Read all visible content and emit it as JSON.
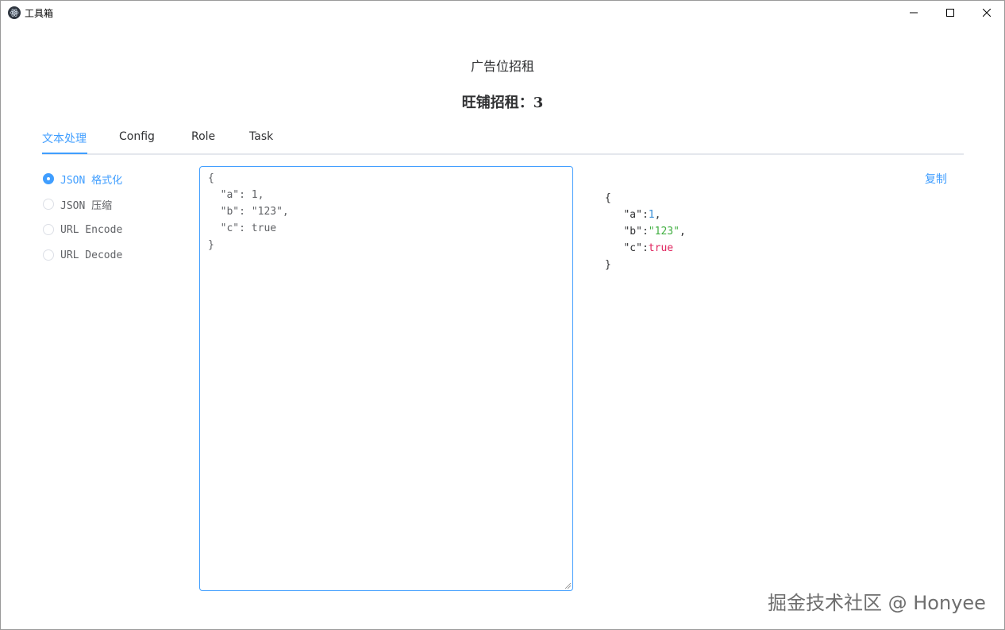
{
  "window": {
    "title": "工具箱",
    "icon": "electron-atom-icon"
  },
  "header": {
    "ad_title": "广告位招租",
    "shop_title": "旺铺招租：3"
  },
  "tabs": [
    {
      "label": "文本处理",
      "active": true
    },
    {
      "label": "Config",
      "active": false
    },
    {
      "label": "Role",
      "active": false
    },
    {
      "label": "Task",
      "active": false
    }
  ],
  "modes": [
    {
      "label": "JSON 格式化",
      "checked": true
    },
    {
      "label": "JSON 压缩",
      "checked": false
    },
    {
      "label": "URL Encode",
      "checked": false
    },
    {
      "label": "URL Decode",
      "checked": false
    }
  ],
  "editor": {
    "value": "{\n  \"a\": 1,\n  \"b\": \"123\",\n  \"c\": true\n}"
  },
  "output": {
    "copy_label": "复制",
    "open_brace": "{",
    "close_brace": "}",
    "entries": [
      {
        "key": "\"a\"",
        "colon": ":",
        "value": "1",
        "comma": ",",
        "type": "number"
      },
      {
        "key": "\"b\"",
        "colon": ":",
        "value": "\"123\"",
        "comma": ",",
        "type": "string"
      },
      {
        "key": "\"c\"",
        "colon": ":",
        "value": "true",
        "comma": "",
        "type": "boolean"
      }
    ]
  },
  "watermark": "掘金技术社区 @ Honyee",
  "colors": {
    "accent": "#409eff",
    "number": "#3a8fd6",
    "string": "#3fae3f",
    "boolean": "#e0245e"
  }
}
